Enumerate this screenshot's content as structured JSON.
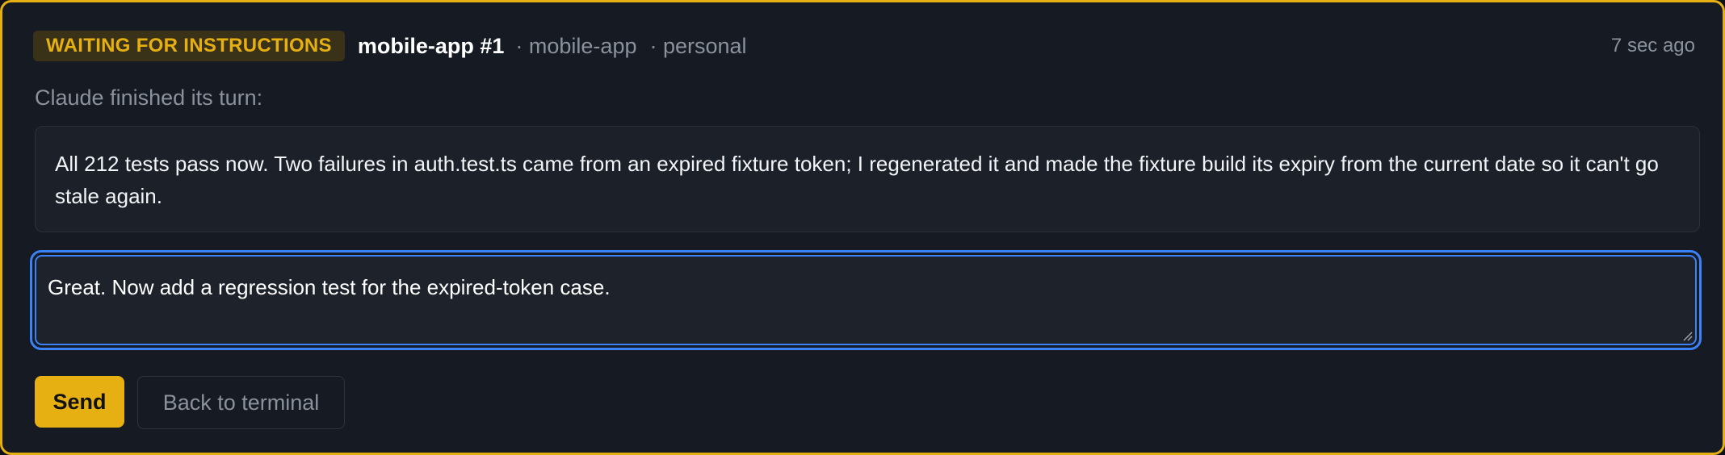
{
  "status_badge": "WAITING FOR INSTRUCTIONS",
  "session": {
    "title": "mobile-app #1",
    "project": "· mobile-app",
    "workspace": "· personal",
    "timestamp": "7 sec ago"
  },
  "intro": "Claude finished its turn:",
  "last_message": "All 212 tests pass now. Two failures in auth.test.ts came from an expired fixture token; I regenerated it and made the fixture build its expiry from the current date so it can't go stale again.",
  "reply_input": {
    "value": "Great. Now add a regression test for the expired-token case."
  },
  "actions": {
    "send_label": "Send",
    "back_label": "Back to terminal"
  },
  "colors": {
    "accent": "#e6b012",
    "focus": "#3b82f6",
    "background": "#151a23"
  }
}
